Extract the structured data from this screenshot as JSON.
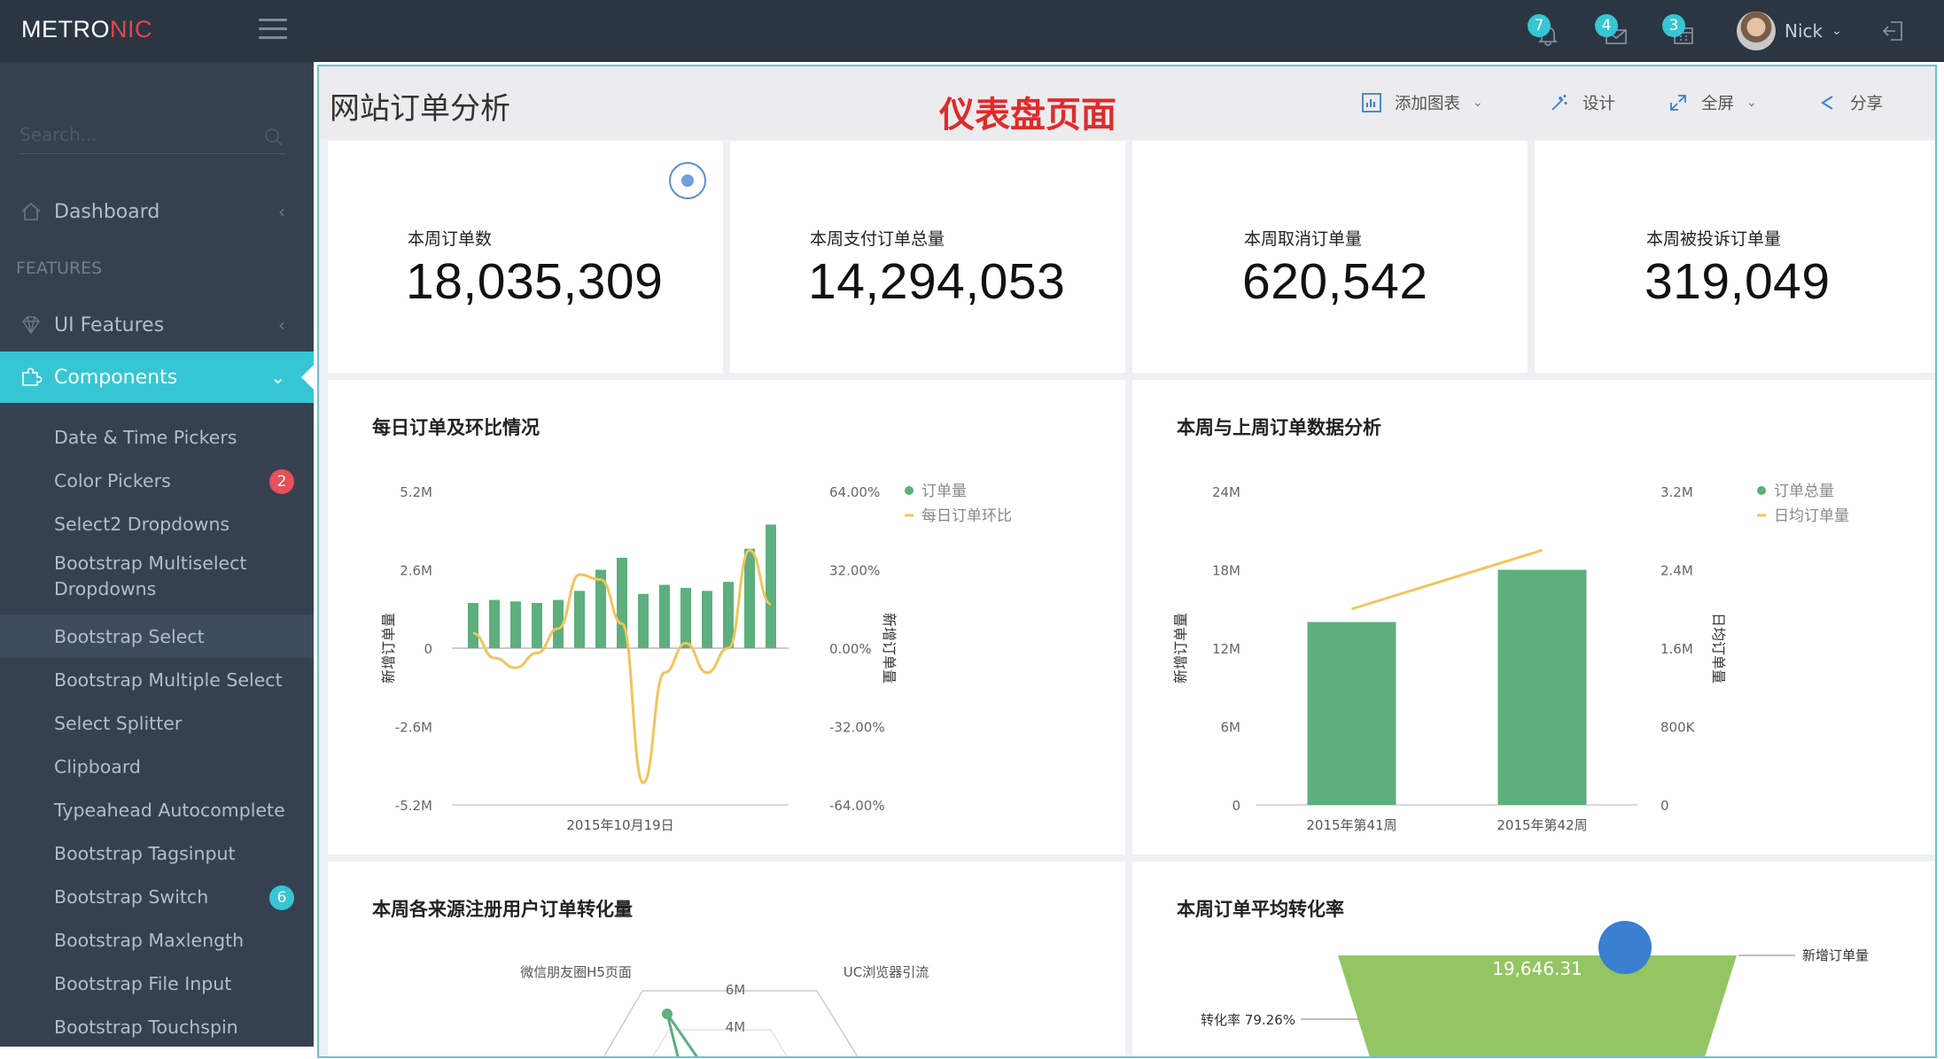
{
  "app": {
    "logo_main": "METRO",
    "logo_accent": "NIC",
    "notifications": [
      {
        "icon": "bell-icon",
        "count": "7"
      },
      {
        "icon": "envelope-icon",
        "count": "4"
      },
      {
        "icon": "calendar-icon",
        "count": "3"
      }
    ],
    "user_name": "Nick"
  },
  "sidebar": {
    "search_placeholder": "Search...",
    "dashboard": "Dashboard",
    "section": "FEATURES",
    "ui_features": "UI Features",
    "components": "Components",
    "items": [
      {
        "label": "Date & Time Pickers"
      },
      {
        "label": "Color Pickers",
        "badge": "2",
        "badge_color": "#e7505a"
      },
      {
        "label": "Select2 Dropdowns"
      },
      {
        "label": "Bootstrap Multiselect Dropdowns"
      },
      {
        "label": "Bootstrap Select"
      },
      {
        "label": "Bootstrap Multiple Select"
      },
      {
        "label": "Select Splitter"
      },
      {
        "label": "Clipboard"
      },
      {
        "label": "Typeahead Autocomplete"
      },
      {
        "label": "Bootstrap Tagsinput"
      },
      {
        "label": "Bootstrap Switch",
        "badge": "6",
        "badge_color": "#36c6d3"
      },
      {
        "label": "Bootstrap Maxlength"
      },
      {
        "label": "Bootstrap File Input"
      },
      {
        "label": "Bootstrap Touchspin"
      }
    ]
  },
  "page": {
    "title": "网站订单分析",
    "tag": "仪表盘页面",
    "tools": {
      "add_chart": "添加图表",
      "design": "设计",
      "fullscreen": "全屏",
      "share": "分享"
    }
  },
  "kpis": [
    {
      "label": "本周订单数",
      "value": "18,035,309"
    },
    {
      "label": "本周支付订单总量",
      "value": "14,294,053"
    },
    {
      "label": "本周取消订单量",
      "value": "620,542"
    },
    {
      "label": "本周被投诉订单量",
      "value": "319,049"
    }
  ],
  "panels": {
    "daily": "每日订单及环比情况",
    "weekly": "本周与上周订单数据分析",
    "source": "本周各来源注册用户订单转化量",
    "conversion": "本周订单平均转化率"
  },
  "colors": {
    "bar": "#5daf7e",
    "line": "#f2c45c",
    "funnel": "#94c563",
    "accent": "#36c6d3"
  },
  "chart_data": [
    {
      "type": "bar",
      "title": "每日订单及环比情况",
      "ylabel": "新增订单量",
      "y2label": "新增订单量",
      "yticks": [
        "5.2M",
        "2.6M",
        "0",
        "-2.6M",
        "-5.2M"
      ],
      "y2ticks": [
        "64.00%",
        "32.00%",
        "0.00%",
        "-32.00%",
        "-64.00%"
      ],
      "ylim": [
        -5.2,
        5.2
      ],
      "y2lim": [
        -64,
        64
      ],
      "xtick": "2015年10月19日",
      "series": [
        {
          "name": "订单量",
          "kind": "bar",
          "values": [
            1.5,
            1.6,
            1.55,
            1.5,
            1.6,
            1.9,
            2.6,
            3.0,
            1.8,
            2.1,
            2.0,
            1.9,
            2.2,
            3.3,
            4.1
          ]
        },
        {
          "name": "每日订单环比",
          "kind": "line",
          "values": [
            6,
            -4,
            -8,
            -2,
            8,
            30,
            28,
            10,
            -55,
            -10,
            2,
            -10,
            0,
            40,
            18
          ]
        }
      ]
    },
    {
      "type": "bar",
      "title": "本周与上周订单数据分析",
      "ylabel": "新增订单量",
      "y2label": "日均订单量",
      "yticks": [
        "24M",
        "18M",
        "12M",
        "6M",
        "0"
      ],
      "y2ticks": [
        "3.2M",
        "2.4M",
        "1.6M",
        "800K",
        "0"
      ],
      "ylim": [
        0,
        24
      ],
      "y2lim": [
        0,
        3.2
      ],
      "categories": [
        "2015年第41周",
        "2015年第42周"
      ],
      "series": [
        {
          "name": "订单总量",
          "kind": "bar",
          "values": [
            14,
            18
          ]
        },
        {
          "name": "日均订单量",
          "kind": "line",
          "values": [
            2.0,
            2.6
          ]
        }
      ]
    },
    {
      "type": "radar",
      "title": "本周各来源注册用户订单转化量",
      "indicators": [
        "微信朋友圈H5页面",
        "UC浏览器引流"
      ],
      "ticks": [
        "6M",
        "4M"
      ]
    },
    {
      "type": "funnel",
      "title": "本周订单平均转化率",
      "stage": "新增订单量",
      "value": "19,646.31",
      "rate_label": "转化率 79.26%"
    }
  ]
}
